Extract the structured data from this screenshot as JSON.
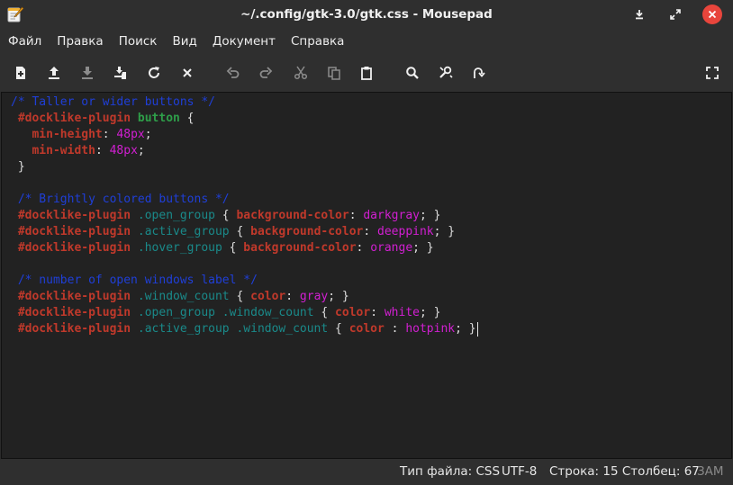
{
  "window": {
    "title": "~/.config/gtk-3.0/gtk.css - Mousepad"
  },
  "menu": [
    "Файл",
    "Правка",
    "Поиск",
    "Вид",
    "Документ",
    "Справка"
  ],
  "toolbar": {
    "buttons": [
      "new-document-icon",
      "open-file-icon",
      "save-icon",
      "save-as-icon",
      "reload-icon",
      "close-icon",
      "undo-icon",
      "redo-icon",
      "cut-icon",
      "copy-icon",
      "paste-icon",
      "search-icon",
      "replace-icon",
      "go-to-line-icon",
      "fullscreen-icon"
    ]
  },
  "editor": {
    "lines": [
      [
        [
          "comment",
          "/* Taller or wider buttons */"
        ]
      ],
      [
        [
          "punc",
          " "
        ],
        [
          "id",
          "#docklike-plugin"
        ],
        [
          "punc",
          " "
        ],
        [
          "el",
          "button"
        ],
        [
          "punc",
          " {"
        ]
      ],
      [
        [
          "punc",
          "   "
        ],
        [
          "prop",
          "min-height"
        ],
        [
          "punc",
          ": "
        ],
        [
          "val",
          "48px"
        ],
        [
          "punc",
          ";"
        ]
      ],
      [
        [
          "punc",
          "   "
        ],
        [
          "prop",
          "min-width"
        ],
        [
          "punc",
          ": "
        ],
        [
          "val",
          "48px"
        ],
        [
          "punc",
          ";"
        ]
      ],
      [
        [
          "punc",
          " }"
        ]
      ],
      [],
      [
        [
          "punc",
          " "
        ],
        [
          "comment",
          "/* Brightly colored buttons */"
        ]
      ],
      [
        [
          "punc",
          " "
        ],
        [
          "id",
          "#docklike-plugin"
        ],
        [
          "punc",
          " "
        ],
        [
          "class",
          ".open_group"
        ],
        [
          "punc",
          " { "
        ],
        [
          "prop",
          "background-color"
        ],
        [
          "punc",
          ": "
        ],
        [
          "val",
          "darkgray"
        ],
        [
          "punc",
          "; }"
        ]
      ],
      [
        [
          "punc",
          " "
        ],
        [
          "id",
          "#docklike-plugin"
        ],
        [
          "punc",
          " "
        ],
        [
          "class",
          ".active_group"
        ],
        [
          "punc",
          " { "
        ],
        [
          "prop",
          "background-color"
        ],
        [
          "punc",
          ": "
        ],
        [
          "val",
          "deeppink"
        ],
        [
          "punc",
          "; }"
        ]
      ],
      [
        [
          "punc",
          " "
        ],
        [
          "id",
          "#docklike-plugin"
        ],
        [
          "punc",
          " "
        ],
        [
          "class",
          ".hover_group"
        ],
        [
          "punc",
          " { "
        ],
        [
          "prop",
          "background-color"
        ],
        [
          "punc",
          ": "
        ],
        [
          "val",
          "orange"
        ],
        [
          "punc",
          "; }"
        ]
      ],
      [],
      [
        [
          "punc",
          " "
        ],
        [
          "comment",
          "/* number of open windows label */"
        ]
      ],
      [
        [
          "punc",
          " "
        ],
        [
          "id",
          "#docklike-plugin"
        ],
        [
          "punc",
          " "
        ],
        [
          "class",
          ".window_count"
        ],
        [
          "punc",
          " { "
        ],
        [
          "prop",
          "color"
        ],
        [
          "punc",
          ": "
        ],
        [
          "val",
          "gray"
        ],
        [
          "punc",
          "; }"
        ]
      ],
      [
        [
          "punc",
          " "
        ],
        [
          "id",
          "#docklike-plugin"
        ],
        [
          "punc",
          " "
        ],
        [
          "class",
          ".open_group .window_count"
        ],
        [
          "punc",
          " { "
        ],
        [
          "prop",
          "color"
        ],
        [
          "punc",
          ": "
        ],
        [
          "val",
          "white"
        ],
        [
          "punc",
          "; }"
        ]
      ],
      [
        [
          "punc",
          " "
        ],
        [
          "id",
          "#docklike-plugin"
        ],
        [
          "punc",
          " "
        ],
        [
          "class",
          ".active_group .window_count"
        ],
        [
          "punc",
          " { "
        ],
        [
          "prop",
          "color"
        ],
        [
          "punc",
          " : "
        ],
        [
          "val",
          "hotpink"
        ],
        [
          "punc",
          "; }"
        ]
      ]
    ]
  },
  "status": {
    "filetype": "Тип файла: CSS",
    "encoding": "UTF-8",
    "position": "Строка: 15 Столбец: 67",
    "mode": "ЗАМ"
  }
}
